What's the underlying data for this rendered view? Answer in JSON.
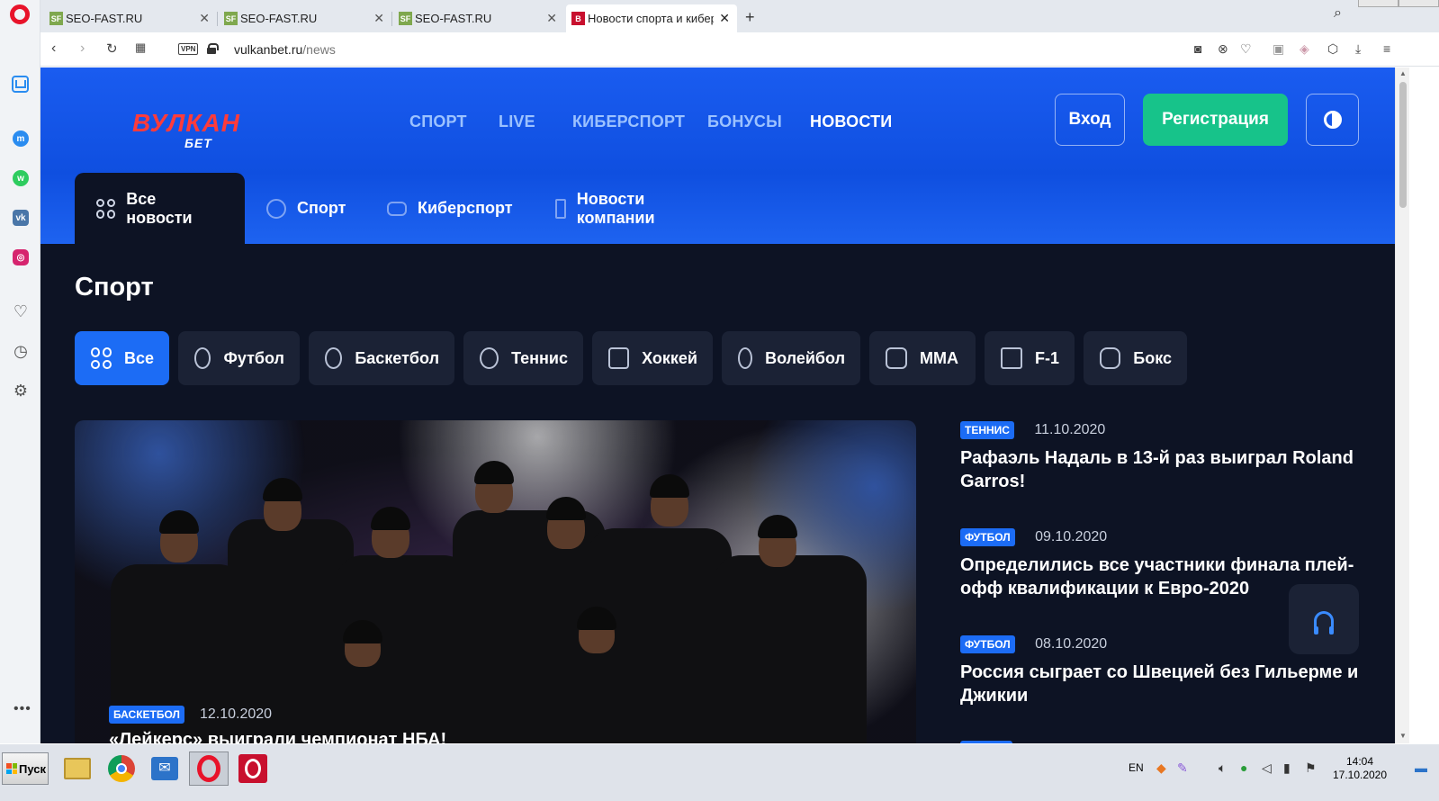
{
  "browser": {
    "tabs": [
      {
        "title": "SEO-FAST.RU",
        "favicon": "SF"
      },
      {
        "title": "SEO-FAST.RU",
        "favicon": "SF"
      },
      {
        "title": "SEO-FAST.RU",
        "favicon": "SF"
      },
      {
        "title": "Новости спорта и кибер",
        "favicon": "B",
        "active": true
      }
    ],
    "url_host": "vulkanbet.ru",
    "url_path": "/news",
    "vpn_label": "VPN"
  },
  "site": {
    "logo_top": "ВУЛКАН",
    "logo_bottom": "БЕТ",
    "nav": [
      "СПОРТ",
      "LIVE",
      "КИБЕРСПОРТ",
      "БОНУСЫ",
      "НОВОСТИ"
    ],
    "nav_active": "НОВОСТИ",
    "login_label": "Вход",
    "register_label": "Регистрация",
    "subtabs": [
      "Все новости",
      "Спорт",
      "Киберспорт",
      "Новости компании"
    ],
    "section_title": "Спорт",
    "chips": [
      "Все",
      "Футбол",
      "Баскетбол",
      "Теннис",
      "Хоккей",
      "Волейбол",
      "ММА",
      "F-1",
      "Бокс"
    ],
    "featured": {
      "badge": "БАСКЕТБОЛ",
      "date": "12.10.2020",
      "title": "«Лейкерс» выиграли чемпионат НБА!"
    },
    "news": [
      {
        "badge": "ТЕННИС",
        "date": "11.10.2020",
        "title": "Рафаэль Надаль в 13-й раз выиграл Roland Garros!"
      },
      {
        "badge": "ФУТБОЛ",
        "date": "09.10.2020",
        "title": "Определились все участники финала плей-офф квалификации к Евро-2020"
      },
      {
        "badge": "ФУТБОЛ",
        "date": "08.10.2020",
        "title": "Россия сыграет со Швецией без Гильерме и Джикии"
      }
    ]
  },
  "taskbar": {
    "start_label": "Пуск",
    "lang": "EN",
    "time": "14:04",
    "date": "17.10.2020"
  },
  "colors": {
    "hero_blue": "#1a5cf0",
    "page_bg": "#0d1324",
    "chip_bg": "#1b2235",
    "accent_blue": "#1c6cf5",
    "register_green": "#17c38a",
    "logo_red": "#ff3b3b"
  }
}
